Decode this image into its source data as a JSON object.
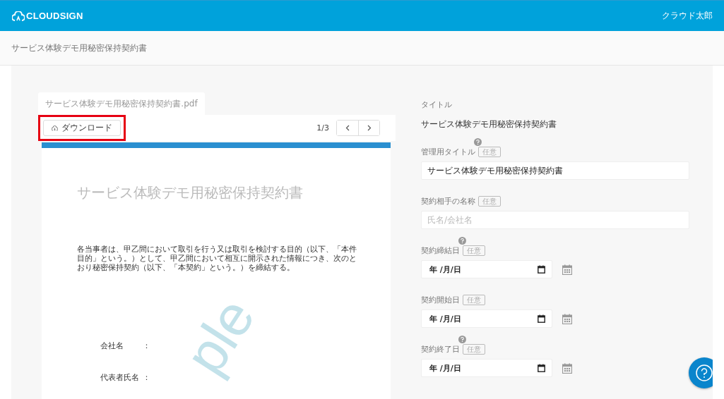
{
  "header": {
    "logo": "CLOUDSIGN",
    "user": "クラウド太郎"
  },
  "page_title": "サービス体験デモ用秘密保持契約書",
  "document": {
    "tab": "サービス体験デモ用秘密保持契約書.pdf",
    "download": {
      "label": "ダウンロード",
      "highlighted": true
    },
    "page_indicator": "1/3",
    "page": {
      "title": "サービス体験デモ用秘密保持契約書",
      "body": "各当事者は、甲乙間において取引を行う又は取引を検討する目的（以下、「本件目的」という。）として、甲乙間において相互に開示された情報につき、次のとおり秘密保持契約（以下、「本契約」という。）を締結する。",
      "fields": [
        {
          "label": "会社名",
          "sep": "："
        },
        {
          "label": "代表者氏名",
          "sep": "："
        }
      ],
      "stamp": "ple"
    }
  },
  "form": {
    "title_label": "タイトル",
    "title_value": "サービス体験デモ用秘密保持契約書",
    "fields": [
      {
        "kind": "text",
        "label": "管理用タイトル",
        "badge": "任意",
        "help": true,
        "value": "サービス体験デモ用秘密保持契約書"
      },
      {
        "kind": "text",
        "label": "契約相手の名称",
        "badge": "任意",
        "help": false,
        "placeholder": "氏名/会社名"
      },
      {
        "kind": "date",
        "label": "契約締結日",
        "badge": "任意",
        "help": true,
        "value": "年 /月/日"
      },
      {
        "kind": "date",
        "label": "契約開始日",
        "badge": "任意",
        "help": false,
        "value": "年 /月/日"
      },
      {
        "kind": "date",
        "label": "契約終了日",
        "badge": "任意",
        "help": true,
        "value": "年 /月/日"
      }
    ]
  }
}
